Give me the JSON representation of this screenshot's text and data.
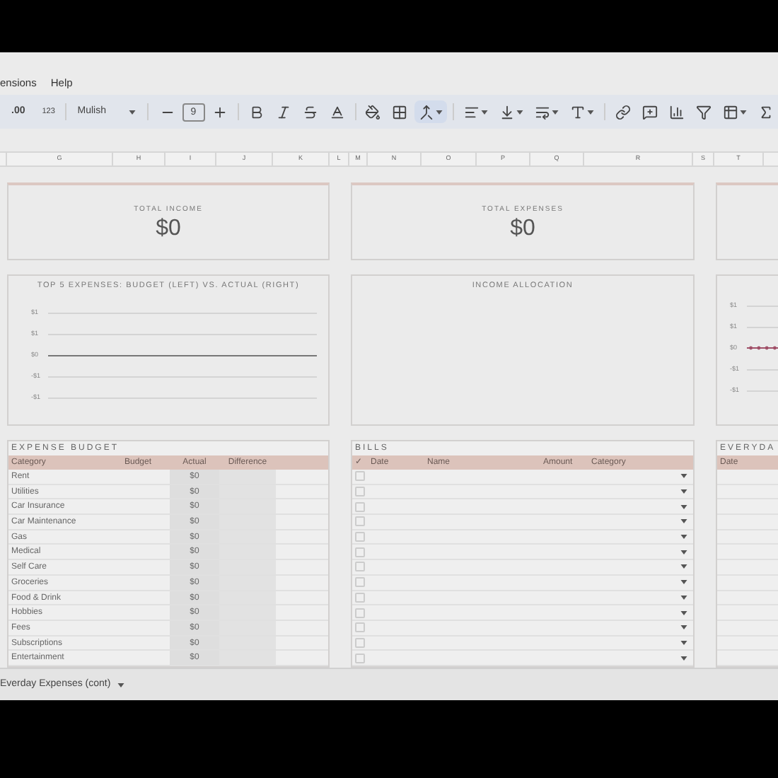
{
  "menu": [
    "ensions",
    "Help"
  ],
  "toolbar": {
    "decimal": ".00",
    "number_format": "123",
    "font": "Mulish",
    "font_size": "9"
  },
  "column_headers": [
    "G",
    "H",
    "I",
    "J",
    "K",
    "L",
    "M",
    "N",
    "O",
    "P",
    "Q",
    "R",
    "S",
    "T"
  ],
  "cards": [
    {
      "label": "TOTAL INCOME",
      "value": "$0"
    },
    {
      "label": "TOTAL EXPENSES",
      "value": "$0"
    }
  ],
  "charts": [
    {
      "title": "TOP 5 EXPENSES: BUDGET (LEFT) VS. ACTUAL (RIGHT)",
      "y_ticks": [
        "$1",
        "$1",
        "$0",
        "-$1",
        "-$1"
      ]
    },
    {
      "title": "INCOME ALLOCATION"
    },
    {
      "y_ticks": [
        "$1",
        "$1",
        "$0",
        "-$1",
        "-$1"
      ]
    }
  ],
  "expense_budget": {
    "title": "EXPENSE BUDGET",
    "columns": [
      "Category",
      "Budget",
      "Actual",
      "Difference"
    ],
    "rows": [
      {
        "category": "Rent",
        "actual": "$0"
      },
      {
        "category": "Utilities",
        "actual": "$0"
      },
      {
        "category": "Car Insurance",
        "actual": "$0"
      },
      {
        "category": "Car Maintenance",
        "actual": "$0"
      },
      {
        "category": "Gas",
        "actual": "$0"
      },
      {
        "category": "Medical",
        "actual": "$0"
      },
      {
        "category": "Self Care",
        "actual": "$0"
      },
      {
        "category": "Groceries",
        "actual": "$0"
      },
      {
        "category": "Food & Drink",
        "actual": "$0"
      },
      {
        "category": "Hobbies",
        "actual": "$0"
      },
      {
        "category": "Fees",
        "actual": "$0"
      },
      {
        "category": "Subscriptions",
        "actual": "$0"
      },
      {
        "category": "Entertainment",
        "actual": "$0"
      }
    ]
  },
  "bills": {
    "title": "BILLS",
    "columns": [
      "✓",
      "Date",
      "Name",
      "Amount",
      "Category"
    ],
    "rows": [
      {
        "checked": false
      },
      {
        "checked": false
      },
      {
        "checked": false
      },
      {
        "checked": false
      },
      {
        "checked": false
      },
      {
        "checked": false
      },
      {
        "checked": false
      },
      {
        "checked": false
      },
      {
        "checked": false
      },
      {
        "checked": false
      },
      {
        "checked": false
      },
      {
        "checked": false
      },
      {
        "checked": false
      }
    ]
  },
  "everyday": {
    "title": "EVERYDA",
    "columns": [
      "Date"
    ]
  },
  "sheet_tab": {
    "label": "Everday Expenses (cont)"
  }
}
